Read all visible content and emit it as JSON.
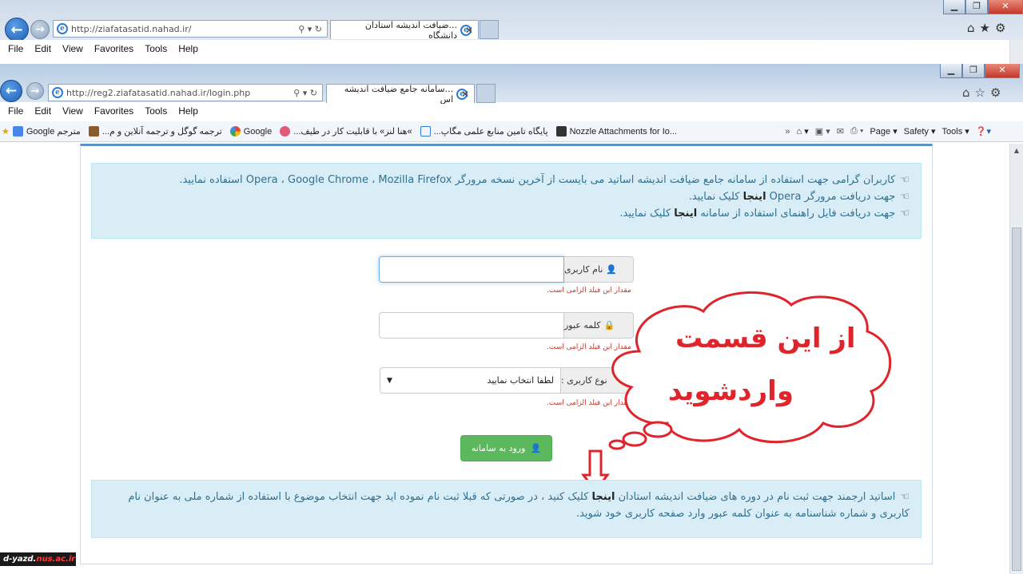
{
  "outer_browser": {
    "address": "http://ziafatasatid.nahad.ir/",
    "tab_title": "...ضیافت اندیشه استادان دانشگاه",
    "menu": [
      "File",
      "Edit",
      "View",
      "Favorites",
      "Tools",
      "Help"
    ]
  },
  "inner_browser": {
    "address": "http://reg2.ziafatasatid.nahad.ir/login.php",
    "tab_title": "...سامانه جامع ضیافت اندیشه اس",
    "menu": [
      "File",
      "Edit",
      "View",
      "Favorites",
      "Tools",
      "Help"
    ],
    "favorites": [
      "Google مترجم",
      "...ترجمه گوگل و ترجمه آنلاین و م",
      "Google",
      "...هنا لنز» با قابلیت کار در طیف«",
      "...پایگاه تامین منابع علمی مگاپ",
      "Nozzle Attachments for Io..."
    ],
    "commands": [
      "Page ▾",
      "Safety ▾",
      "Tools ▾"
    ]
  },
  "notice_top": {
    "line1": "کاربران گرامی جهت استفاده از سامانه جامع ضیافت اندیشه اساتید می بایست از آخرین نسخه مرورگر Opera ، Google Chrome ، Mozilla Firefox استفاده نمایید.",
    "line2_pre": "جهت دریافت مرورگر Opera",
    "line2_link": "اینجا",
    "line2_post": "کلیک نمایید.",
    "line3_pre": "جهت دریافت فایل راهنمای استفاده از سامانه",
    "line3_link": "اینجا",
    "line3_post": "کلیک نمایید."
  },
  "form": {
    "username_label": "نام کاربری",
    "username_error": "مقدار این فیلد الزامی است.",
    "password_label": "کلمه عبور",
    "password_error": "مقدار این فیلد الزامی است.",
    "usertype_label": "نوع کاربری :",
    "usertype_selected": "لطفا انتخاب نمایید",
    "usertype_error": "مقدار این فیلد الزامی است.",
    "submit": "ورود به سامانه"
  },
  "notice_bottom": {
    "pre": "اساتید ارجمند جهت ثبت نام در دوره های ضیافت اندیشه استادان",
    "link": "اینجا",
    "post": "کلیک کنید ، در صورتی که قبلا ثبت نام نموده اید جهت انتخاب موضوع با استفاده از شماره ملی به عنوان نام کاربری و شماره شناسنامه به عنوان کلمه عبور وارد صفحه کاربری خود شوید."
  },
  "callout": {
    "line1": "از این قسمت",
    "line2": "واردشوید",
    "color": "#e0242c"
  },
  "watermark": {
    "prefix": "d-yazd.",
    "suffix": "nus.ac.ir"
  }
}
